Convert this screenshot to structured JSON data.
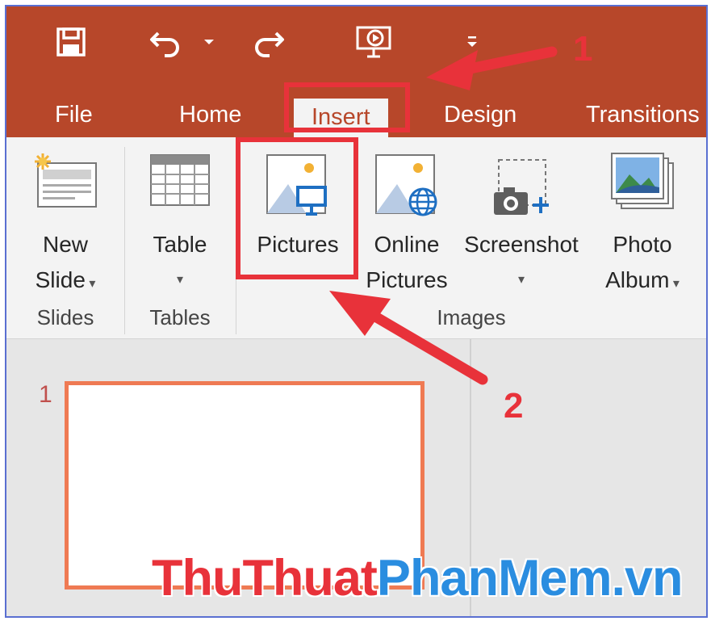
{
  "qat": {
    "icons": [
      "save-icon",
      "undo-icon",
      "undo-dropdown-icon",
      "redo-icon",
      "start-slideshow-icon",
      "customize-qat-icon"
    ]
  },
  "tabs": [
    {
      "label": "File",
      "active": false
    },
    {
      "label": "Home",
      "active": false
    },
    {
      "label": "Insert",
      "active": true
    },
    {
      "label": "Design",
      "active": false
    },
    {
      "label": "Transitions",
      "active": false
    }
  ],
  "ribbon": {
    "groups": {
      "slides": "Slides",
      "tables": "Tables",
      "images": "Images"
    },
    "commands": {
      "new_slide": {
        "line1": "New",
        "line2": "Slide"
      },
      "table": {
        "line1": "Table"
      },
      "pictures": {
        "line1": "Pictures"
      },
      "online_pictures": {
        "line1": "Online",
        "line2": "Pictures"
      },
      "screenshot": {
        "line1": "Screenshot"
      },
      "photo_album": {
        "line1": "Photo",
        "line2": "Album"
      }
    }
  },
  "thumbnails": [
    {
      "number": "1"
    }
  ],
  "annotations": {
    "step1": "1",
    "step2": "2",
    "highlight_color": "#e8323a"
  },
  "watermark": {
    "part1": "ThuThuat",
    "part2": "PhanMem.vn"
  },
  "colors": {
    "accent": "#b7472a",
    "ribbon_bg": "#f3f3f3",
    "thumb_border": "#ef7a53"
  }
}
